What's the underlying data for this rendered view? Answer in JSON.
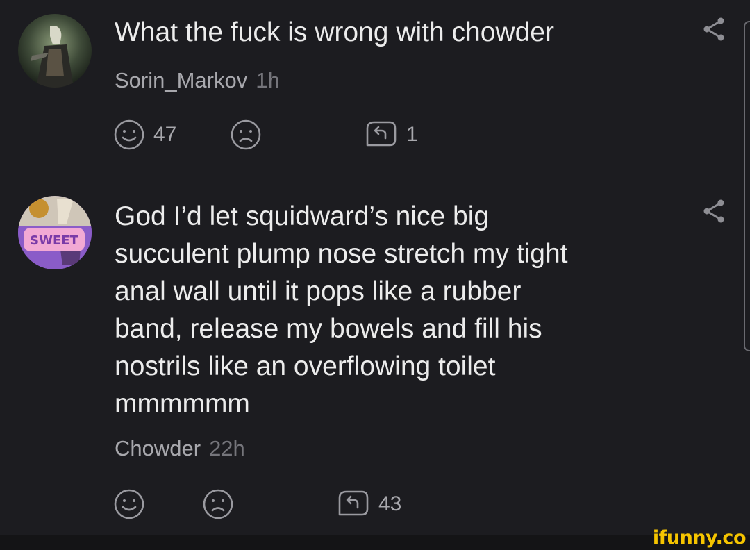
{
  "comments": [
    {
      "text": "What the fuck is wrong with chowder",
      "author": "Sorin_Markov",
      "time": "1h",
      "likes": "47",
      "dislikes": "",
      "replies": "1"
    },
    {
      "text": "God I’d let squidward’s nice big\nsucculent plump nose stretch my tight\nanal wall until it pops like a rubber\nband, release my bowels and fill his\nnostrils like an overflowing toilet\nmmmmmm",
      "author": "Chowder",
      "time": "22h",
      "likes": "",
      "dislikes": "",
      "replies": "43",
      "avatar_badge": "SWEET"
    }
  ],
  "watermark": "ifunny.co",
  "icons": {
    "like": "smile-icon",
    "dislike": "frown-icon",
    "reply": "reply-icon",
    "share": "share-icon"
  },
  "colors": {
    "background": "#1c1c20",
    "text": "#ececec",
    "meta": "#a8a8ad",
    "watermark": "#f5c400"
  }
}
